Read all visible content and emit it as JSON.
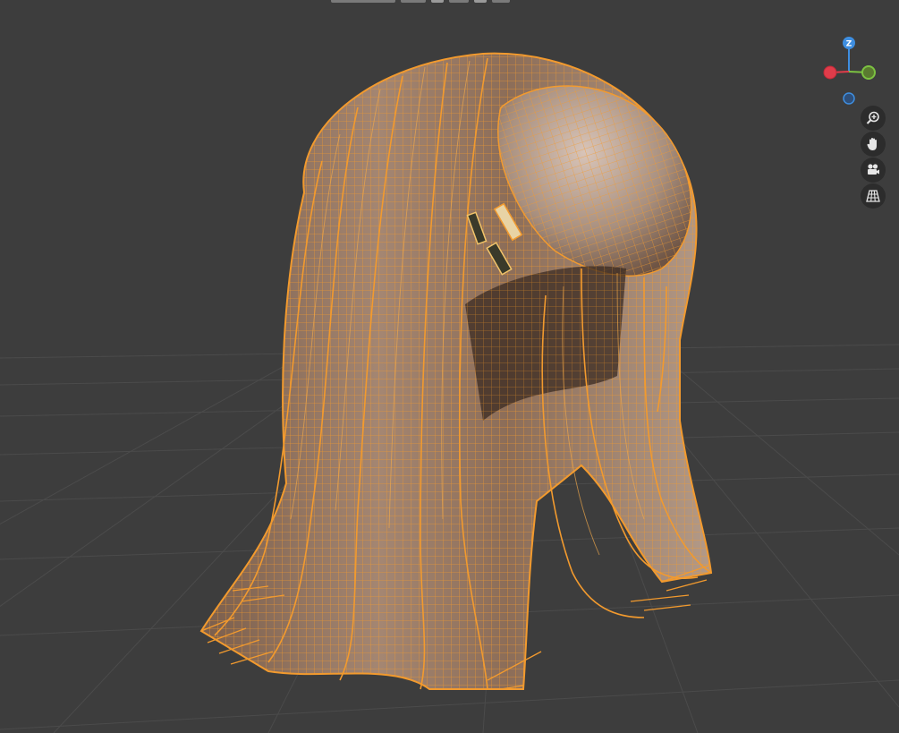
{
  "viewport": {
    "background": "#3d3d3d",
    "grid_color": "#4a4a4a",
    "selection_color": "#f29a2e",
    "object": "hair-mesh-in-edit-mode"
  },
  "gizmo": {
    "z_label": "Z",
    "x_color": "#e03c4a",
    "y_color": "#7cc241",
    "z_color": "#3e8ee0"
  },
  "nav_buttons": [
    {
      "name": "zoom",
      "icon": "zoom-in-icon"
    },
    {
      "name": "pan",
      "icon": "hand-icon"
    },
    {
      "name": "camera",
      "icon": "camera-icon"
    },
    {
      "name": "perspective",
      "icon": "grid-perspective-icon"
    }
  ]
}
